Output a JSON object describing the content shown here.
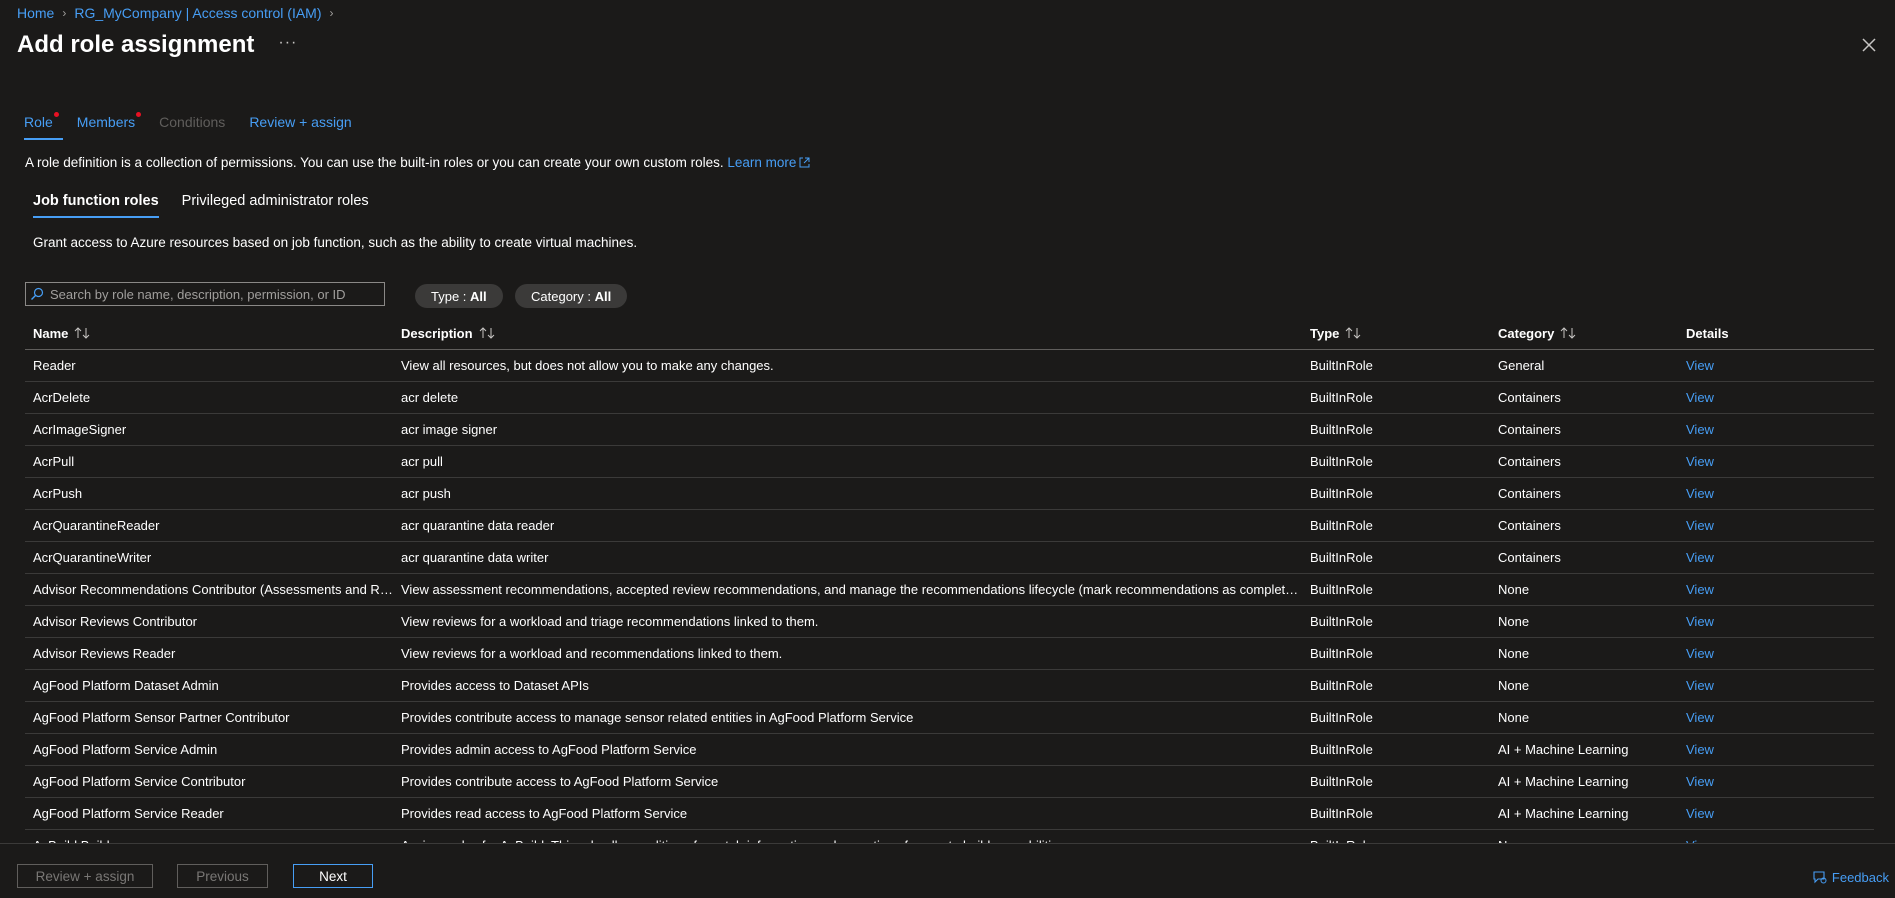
{
  "breadcrumb": [
    "Home",
    "RG_MyCompany | Access control (IAM)"
  ],
  "title": "Add role assignment",
  "tabs": [
    {
      "label": "Role"
    },
    {
      "label": "Members"
    },
    {
      "label": "Conditions"
    },
    {
      "label": "Review + assign"
    }
  ],
  "description": "A role definition is a collection of permissions. You can use the built-in roles or you can create your own custom roles.",
  "learn_more": "Learn more",
  "subtabs": [
    "Job function roles",
    "Privileged administrator roles"
  ],
  "subtab_description": "Grant access to Azure resources based on job function, such as the ability to create virtual machines.",
  "search": {
    "placeholder": "Search by role name, description, permission, or ID"
  },
  "filters": [
    {
      "label": "Type : ",
      "value": "All"
    },
    {
      "label": "Category : ",
      "value": "All"
    }
  ],
  "columns": [
    "Name",
    "Description",
    "Type",
    "Category",
    "Details"
  ],
  "rows": [
    [
      "Reader",
      "View all resources, but does not allow you to make any changes.",
      "BuiltInRole",
      "General",
      "View"
    ],
    [
      "AcrDelete",
      "acr delete",
      "BuiltInRole",
      "Containers",
      "View"
    ],
    [
      "AcrImageSigner",
      "acr image signer",
      "BuiltInRole",
      "Containers",
      "View"
    ],
    [
      "AcrPull",
      "acr pull",
      "BuiltInRole",
      "Containers",
      "View"
    ],
    [
      "AcrPush",
      "acr push",
      "BuiltInRole",
      "Containers",
      "View"
    ],
    [
      "AcrQuarantineReader",
      "acr quarantine data reader",
      "BuiltInRole",
      "Containers",
      "View"
    ],
    [
      "AcrQuarantineWriter",
      "acr quarantine data writer",
      "BuiltInRole",
      "Containers",
      "View"
    ],
    [
      "Advisor Recommendations Contributor (Assessments and Re...",
      "View assessment recommendations, accepted review recommendations, and manage the recommendations lifecycle (mark recommendations as completed...",
      "BuiltInRole",
      "None",
      "View"
    ],
    [
      "Advisor Reviews Contributor",
      "View reviews for a workload and triage recommendations linked to them.",
      "BuiltInRole",
      "None",
      "View"
    ],
    [
      "Advisor Reviews Reader",
      "View reviews for a workload and recommendations linked to them.",
      "BuiltInRole",
      "None",
      "View"
    ],
    [
      "AgFood Platform Dataset Admin",
      "Provides access to Dataset APIs",
      "BuiltInRole",
      "None",
      "View"
    ],
    [
      "AgFood Platform Sensor Partner Contributor",
      "Provides contribute access to manage sensor related entities in AgFood Platform Service",
      "BuiltInRole",
      "None",
      "View"
    ],
    [
      "AgFood Platform Service Admin",
      "Provides admin access to AgFood Platform Service",
      "BuiltInRole",
      "AI + Machine Learning",
      "View"
    ],
    [
      "AgFood Platform Service Contributor",
      "Provides contribute access to AgFood Platform Service",
      "BuiltInRole",
      "AI + Machine Learning",
      "View"
    ],
    [
      "AgFood Platform Service Reader",
      "Provides read access to AgFood Platform Service",
      "BuiltInRole",
      "AI + Machine Learning",
      "View"
    ],
    [
      "AzBuild Builder",
      "Assigns roles for AzBuild. This role allows editing of any tab information and operations for create builds capabilities",
      "BuiltInRole",
      "None",
      "View"
    ]
  ],
  "footer": {
    "review_assign": "Review + assign",
    "previous": "Previous",
    "next": "Next",
    "feedback": "Feedback"
  }
}
